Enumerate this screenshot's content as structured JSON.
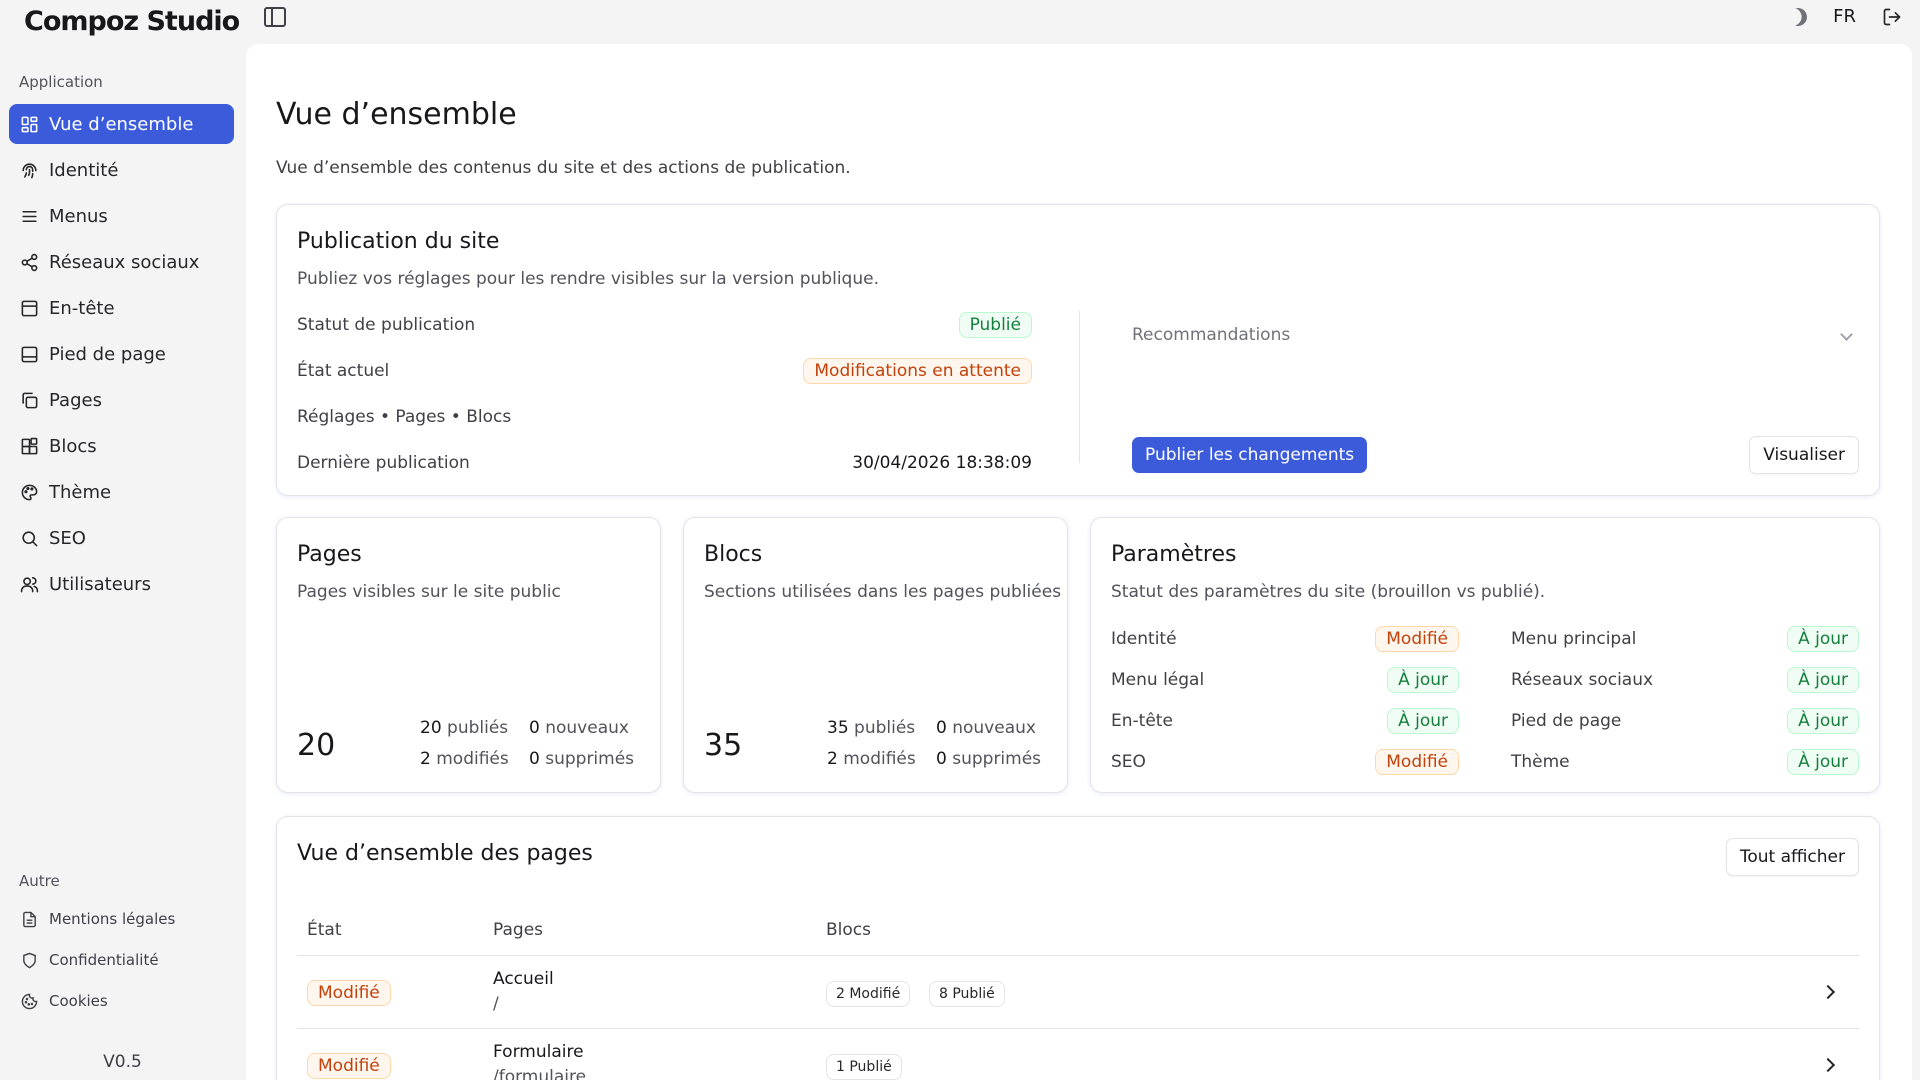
{
  "app": {
    "brand": "Compoz Studio",
    "lang": "FR",
    "version": "V0.5"
  },
  "sidebar": {
    "section_app": "Application",
    "items": [
      {
        "label": "Vue d’ensemble",
        "icon": "dashboard-icon"
      },
      {
        "label": "Identité",
        "icon": "fingerprint-icon"
      },
      {
        "label": "Menus",
        "icon": "menu-icon"
      },
      {
        "label": "Réseaux sociaux",
        "icon": "share-icon"
      },
      {
        "label": "En-tête",
        "icon": "header-layout-icon"
      },
      {
        "label": "Pied de page",
        "icon": "footer-layout-icon"
      },
      {
        "label": "Pages",
        "icon": "copy-icon"
      },
      {
        "label": "Blocs",
        "icon": "blocks-icon"
      },
      {
        "label": "Thème",
        "icon": "palette-icon"
      },
      {
        "label": "SEO",
        "icon": "search-icon"
      },
      {
        "label": "Utilisateurs",
        "icon": "users-icon"
      }
    ],
    "section_other": "Autre",
    "other_items": [
      {
        "label": "Mentions légales",
        "icon": "file-text-icon"
      },
      {
        "label": "Confidentialité",
        "icon": "shield-icon"
      },
      {
        "label": "Cookies",
        "icon": "cookie-icon"
      }
    ]
  },
  "main": {
    "title": "Vue d’ensemble",
    "subtitle": "Vue d’ensemble des contenus du site et des actions de publication."
  },
  "publication": {
    "title": "Publication du site",
    "desc": "Publiez vos réglages pour les rendre visibles sur la version publique.",
    "status_label": "Statut de publication",
    "status_value": "Publié",
    "state_label": "État actuel",
    "state_value": "Modifications en attente",
    "scope": "Réglages • Pages • Blocs",
    "last_label": "Dernière publication",
    "last_value": "30/04/2026 18:38:09",
    "recommendations": "Recommandations",
    "publish_button": "Publier les changements",
    "preview_button": "Visualiser"
  },
  "pages_card": {
    "title": "Pages",
    "desc": "Pages visibles sur le site public",
    "total": "20",
    "published_n": "20",
    "published_l": "publiés",
    "new_n": "0",
    "new_l": "nouveaux",
    "modified_n": "2",
    "modified_l": "modifiés",
    "deleted_n": "0",
    "deleted_l": "supprimés"
  },
  "blocs_card": {
    "title": "Blocs",
    "desc": "Sections utilisées dans les pages publiées",
    "total": "35",
    "published_n": "35",
    "published_l": "publiés",
    "new_n": "0",
    "new_l": "nouveaux",
    "modified_n": "2",
    "modified_l": "modifiés",
    "deleted_n": "0",
    "deleted_l": "supprimés"
  },
  "params_card": {
    "title": "Paramètres",
    "desc": "Statut des paramètres du site (brouillon vs publié).",
    "items": [
      {
        "label": "Identité",
        "status": "Modifié"
      },
      {
        "label": "Menu principal",
        "status": "À jour"
      },
      {
        "label": "Menu légal",
        "status": "À jour"
      },
      {
        "label": "Réseaux sociaux",
        "status": "À jour"
      },
      {
        "label": "En-tête",
        "status": "À jour"
      },
      {
        "label": "Pied de page",
        "status": "À jour"
      },
      {
        "label": "SEO",
        "status": "Modifié"
      },
      {
        "label": "Thème",
        "status": "À jour"
      }
    ]
  },
  "pages_overview": {
    "title": "Vue d’ensemble des pages",
    "show_all": "Tout afficher",
    "columns": [
      "État",
      "Pages",
      "Blocs"
    ],
    "rows": [
      {
        "state": "Modifié",
        "name": "Accueil",
        "path": "/",
        "blocks": [
          "2 Modifié",
          "8 Publié"
        ]
      },
      {
        "state": "Modifié",
        "name": "Formulaire",
        "path": "/formulaire",
        "blocks": [
          "1 Publié"
        ]
      }
    ]
  },
  "colors": {
    "accent": "#3b5bdb",
    "success": "#15803d",
    "warning": "#c2410c"
  }
}
